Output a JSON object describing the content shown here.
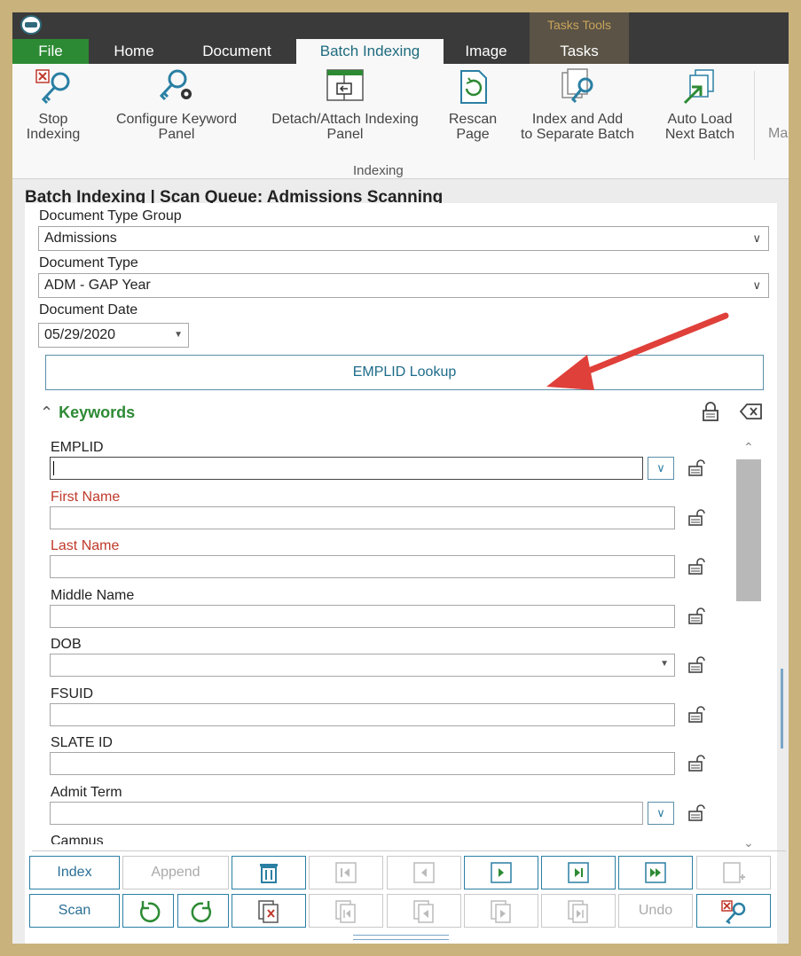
{
  "tabs": {
    "file": "File",
    "home": "Home",
    "document": "Document",
    "batch_indexing": "Batch Indexing",
    "image": "Image",
    "tasks_tools": "Tasks Tools",
    "tasks": "Tasks"
  },
  "ribbon": {
    "stop_indexing": [
      "Stop",
      "Indexing"
    ],
    "configure_keyword_panel": [
      "Configure Keyword",
      "Panel"
    ],
    "detach_attach": [
      "Detach/Attach Indexing",
      "Panel"
    ],
    "rescan_page": [
      "Rescan",
      "Page"
    ],
    "index_add": [
      "Index and Add",
      "to Separate Batch"
    ],
    "auto_load": [
      "Auto Load",
      "Next Batch"
    ],
    "more": "Ma",
    "group_label": "Indexing"
  },
  "panel": {
    "title": "Batch Indexing | Scan Queue: Admissions Scanning",
    "doc_type_group_label": "Document Type Group",
    "doc_type_group_value": "Admissions",
    "doc_type_label": "Document Type",
    "doc_type_value": "ADM - GAP Year",
    "doc_date_label": "Document Date",
    "doc_date_value": "05/29/2020",
    "lookup_button": "EMPLID Lookup",
    "keywords_header": "Keywords"
  },
  "keywords": [
    {
      "label": "EMPLID",
      "value": "",
      "required": false,
      "dropdown": "button"
    },
    {
      "label": "First Name",
      "value": "",
      "required": true,
      "dropdown": "none"
    },
    {
      "label": "Last Name",
      "value": "",
      "required": true,
      "dropdown": "none"
    },
    {
      "label": "Middle Name",
      "value": "",
      "required": false,
      "dropdown": "none"
    },
    {
      "label": "DOB",
      "value": "",
      "required": false,
      "dropdown": "arrow"
    },
    {
      "label": "FSUID",
      "value": "",
      "required": false,
      "dropdown": "none"
    },
    {
      "label": "SLATE ID",
      "value": "",
      "required": false,
      "dropdown": "none"
    },
    {
      "label": "Admit Term",
      "value": "",
      "required": false,
      "dropdown": "button"
    },
    {
      "label": "Campus",
      "value": "",
      "required": false,
      "dropdown": "none"
    }
  ],
  "toolbar": {
    "index": "Index",
    "append": "Append",
    "scan": "Scan",
    "undo": "Undo"
  },
  "colors": {
    "accent": "#2a7fa3",
    "file_tab": "#2d8a34",
    "required": "#c0392b",
    "keywords_header": "#2d8a34",
    "arrow": "#e0403a"
  }
}
